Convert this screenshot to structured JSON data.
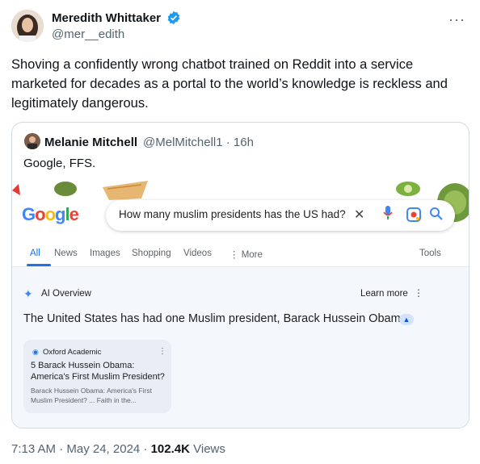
{
  "tweet": {
    "author_name": "Meredith Whittaker",
    "author_handle": "@mer__edith",
    "more_label": "···",
    "text": "Shoving a confidently wrong chatbot trained on Reddit into a service marketed for decades as a portal to the world’s knowledge is reckless and legitimately dangerous.",
    "timestamp": "7:13 AM · May 24, 2024 · ",
    "views_count": "102.4K",
    "views_label": " Views"
  },
  "quote": {
    "author_name": "Melanie Mitchell",
    "author_handle_time": "@MelMitchell1 · 16h",
    "text": "Google, FFS."
  },
  "google": {
    "logo": "Google",
    "query": "How many muslim presidents has the US had?",
    "tabs": [
      "All",
      "News",
      "Images",
      "Shopping",
      "Videos",
      "⋮ More",
      "Tools"
    ],
    "ai_overview_label": "AI Overview",
    "learn_more_label": "Learn more",
    "answer": "The United States has had one Muslim president, Barack Hussein Obama.",
    "source": {
      "site": "Oxford Academic",
      "title": "5 Barack Hussein Obama: America's First Muslim President?",
      "snippet": "Barack Hussein Obama: America's First Muslim President? ... Faith in the..."
    }
  },
  "colors": {
    "accent": "#1a73e8",
    "verified": "#1d9bf0",
    "muted": "#536471"
  }
}
